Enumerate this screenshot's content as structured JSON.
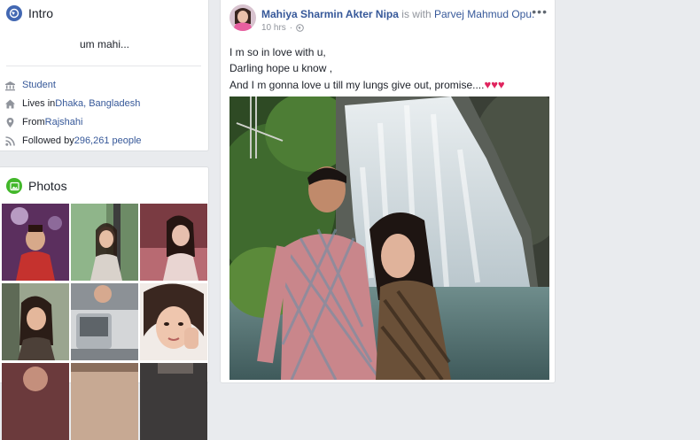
{
  "intro": {
    "title": "Intro",
    "bio": "um mahi...",
    "rows": [
      {
        "icon": "school-icon",
        "parts": [
          "",
          "Student"
        ]
      },
      {
        "icon": "home-icon",
        "parts": [
          "Lives in ",
          "Dhaka, Bangladesh"
        ]
      },
      {
        "icon": "location-pin-icon",
        "parts": [
          "From ",
          "Rajshahi"
        ]
      },
      {
        "icon": "rss-icon",
        "parts": [
          "Followed by ",
          "296,261 people"
        ]
      }
    ]
  },
  "photos": {
    "title": "Photos"
  },
  "post": {
    "author": "Mahiya Sharmin Akter Nipa",
    "with_text": " is with ",
    "tagged": "Parvej Mahmud Opu.",
    "time": "10 hrs",
    "separator": "·",
    "more": "•••",
    "lines": [
      "I m so in love with u,",
      "Darling hope u know ,",
      "And I m gonna love u till my lungs give out, promise...."
    ],
    "hearts": "♥♥♥"
  },
  "colors": {
    "link": "#365899",
    "heart": "#e0245e",
    "intro_icon": "#4267b2",
    "photos_icon": "#42b72a"
  }
}
